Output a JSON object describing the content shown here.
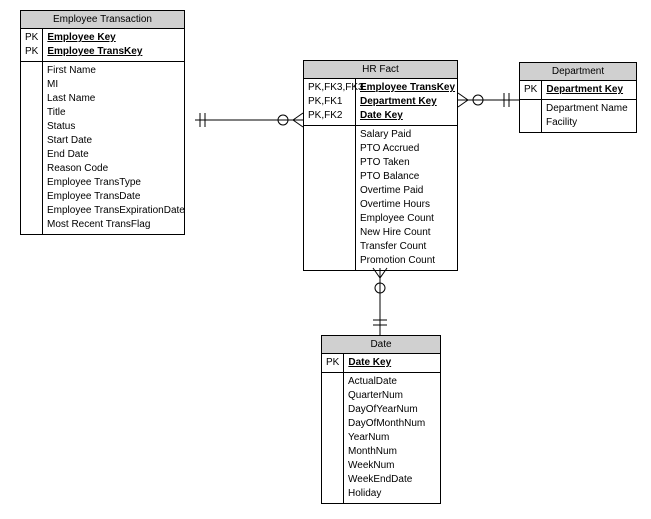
{
  "entities": {
    "employeeTransaction": {
      "title": "Employee Transaction",
      "keys": [
        {
          "pk": "PK",
          "name": "Employee Key"
        },
        {
          "pk": "PK",
          "name": "Employee TransKey"
        }
      ],
      "attrs": [
        "First Name",
        "MI",
        "Last Name",
        "Title",
        "Status",
        "Start Date",
        "End Date",
        "Reason Code",
        "Employee TransType",
        "Employee TransDate",
        "Employee TransExpirationDate",
        "Most Recent TransFlag"
      ]
    },
    "hrFact": {
      "title": "HR Fact",
      "keys": [
        {
          "pk": "PK,FK3,FK3",
          "name": "Employee TransKey"
        },
        {
          "pk": "PK,FK1",
          "name": "Department Key"
        },
        {
          "pk": "PK,FK2",
          "name": "Date Key"
        }
      ],
      "attrs": [
        "Salary Paid",
        "PTO Accrued",
        "PTO Taken",
        "PTO Balance",
        "Overtime Paid",
        "Overtime Hours",
        "Employee Count",
        "New Hire Count",
        "Transfer Count",
        "Promotion Count"
      ]
    },
    "department": {
      "title": "Department",
      "keys": [
        {
          "pk": "PK",
          "name": "Department Key"
        }
      ],
      "attrs": [
        "Department Name",
        "Facility"
      ]
    },
    "date": {
      "title": "Date",
      "keys": [
        {
          "pk": "PK",
          "name": "Date Key"
        }
      ],
      "attrs": [
        "ActualDate",
        "QuarterNum",
        "DayOfYearNum",
        "DayOfMonthNum",
        "YearNum",
        "MonthNum",
        "WeekNum",
        "WeekEndDate",
        "Holiday"
      ]
    }
  }
}
